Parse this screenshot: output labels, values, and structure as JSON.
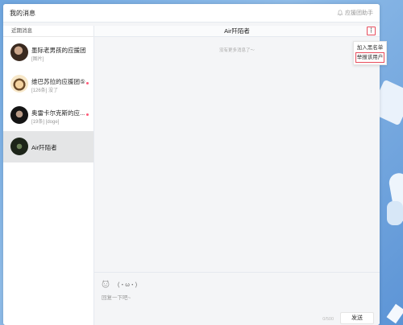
{
  "topbar": {
    "title": "我的消息",
    "assistant_label": "应援团助手",
    "assistant_icon": "bell-icon"
  },
  "sidebar": {
    "header": "近期消息",
    "conversations": [
      {
        "name": "墨际老男孩的应援团⑤",
        "preview": "[图片]",
        "unread": false
      },
      {
        "name": "维巴苏拉的应援团⑤",
        "preview": "[126条] 没了",
        "unread": true
      },
      {
        "name": "奥雷卡尔克斯的应...",
        "preview": "[19条] [doge]",
        "unread": true
      },
      {
        "name": "Air阡陌者",
        "preview": "",
        "unread": false,
        "active": true
      }
    ]
  },
  "chat": {
    "title": "Air阡陌者",
    "no_more_text": "没有更多消息了～",
    "more_icon": "more-vertical-icon"
  },
  "menu": {
    "items": [
      "加入黑名单",
      "举报该用户"
    ],
    "highlighted_index": 1
  },
  "input": {
    "kaomoji": "(・ω・)",
    "placeholder": "回复一下吧~",
    "counter": "0/500",
    "send_label": "发送"
  },
  "colors": {
    "accent_red": "#e74c5c",
    "unread_dot": "#ff5a78",
    "background_blue": "#6fa6df"
  }
}
